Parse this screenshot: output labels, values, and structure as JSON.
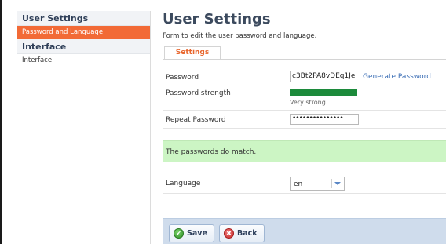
{
  "sidebar": {
    "sections": [
      {
        "title": "User Settings",
        "items": [
          {
            "label": "Password and Language",
            "active": true
          }
        ]
      },
      {
        "title": "Interface",
        "items": [
          {
            "label": "Interface",
            "active": false
          }
        ]
      }
    ]
  },
  "main": {
    "title": "User Settings",
    "description": "Form to edit the user password and language.",
    "tabs": [
      {
        "label": "Settings",
        "active": true
      }
    ],
    "password": {
      "label": "Password",
      "value": "c3Bt2PA8vDEq1Je",
      "generate_label": "Generate Password"
    },
    "strength": {
      "label": "Password strength",
      "text": "Very strong",
      "level_percent": 100,
      "color": "#1c8a3b"
    },
    "repeat_password": {
      "label": "Repeat Password",
      "masked_value": "•••••••••••••••"
    },
    "match_message": "The passwords do match.",
    "language": {
      "label": "Language",
      "selected": "en"
    },
    "buttons": {
      "save_label": "Save",
      "back_label": "Back"
    }
  },
  "colors": {
    "accent_orange": "#f26a36",
    "success_bg": "#ccf5c4",
    "footer_bg": "#cfdcec",
    "link": "#3b6eb5"
  },
  "icons": {
    "save": "check-circle-icon",
    "back": "cancel-circle-icon",
    "select_arrow": "chevron-down-icon"
  }
}
